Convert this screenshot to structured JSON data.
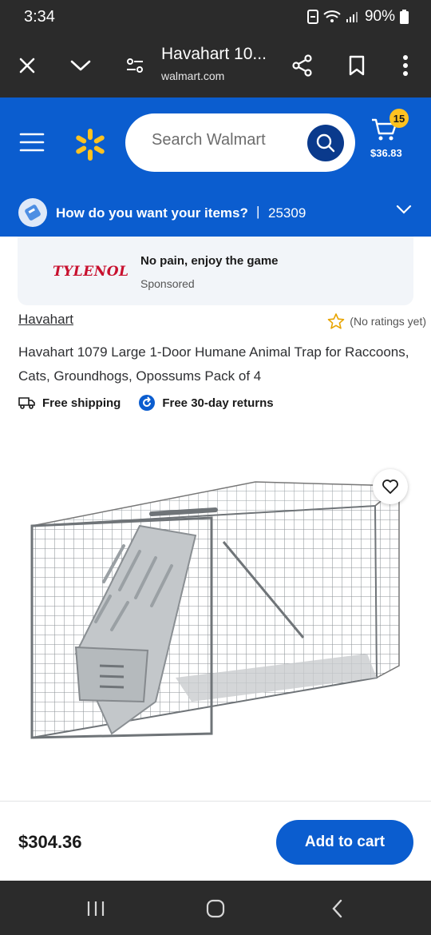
{
  "status_bar": {
    "time": "3:34",
    "battery": "90%"
  },
  "browser": {
    "page_title": "Havahart 10...",
    "url": "walmart.com",
    "icons": [
      "close-icon",
      "chevron-down-icon",
      "page-settings-icon",
      "share-icon",
      "bookmark-icon",
      "more-vert-icon"
    ]
  },
  "header": {
    "search_placeholder": "Search Walmart",
    "cart_count": "15",
    "cart_total": "$36.83",
    "brand_color": "#0b5dcf",
    "accent_color": "#ffc220"
  },
  "delivery": {
    "question": "How do you want your items?",
    "separator": "|",
    "zip": "25309"
  },
  "sponsored": {
    "logo_text": "TYLENOL",
    "title": "No pain, enjoy the game",
    "label": "Sponsored"
  },
  "product": {
    "brand": "Havahart",
    "rating_text": "(No ratings yet)",
    "title": "Havahart 1079 Large 1-Door Humane Animal Trap for Raccoons, Cats, Groundhogs, Opossums Pack of 4",
    "perks": [
      "Free shipping",
      "Free 30-day returns"
    ],
    "price": "$304.36",
    "add_to_cart": "Add to cart"
  }
}
